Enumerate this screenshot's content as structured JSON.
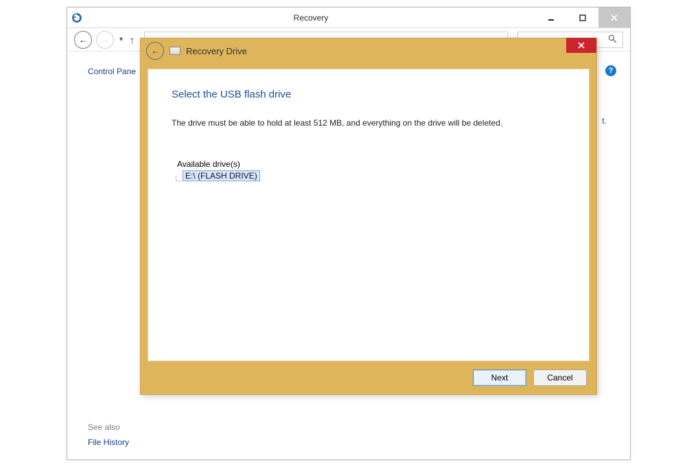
{
  "parent_window": {
    "title": "Recovery",
    "breadcrumb": "Control Pane",
    "obscured_text": "t.",
    "see_also_label": "See also",
    "file_history_link": "File History"
  },
  "help_icon": {
    "glyph": "?"
  },
  "wizard": {
    "title": "Recovery Drive",
    "heading": "Select the USB flash drive",
    "note": "The drive must be able to hold at least 512 MB, and everything on the drive will be deleted.",
    "available_label": "Available drive(s)",
    "drives": [
      {
        "label": "E:\\ (FLASH DRIVE)"
      }
    ],
    "buttons": {
      "next": "Next",
      "cancel": "Cancel"
    }
  }
}
